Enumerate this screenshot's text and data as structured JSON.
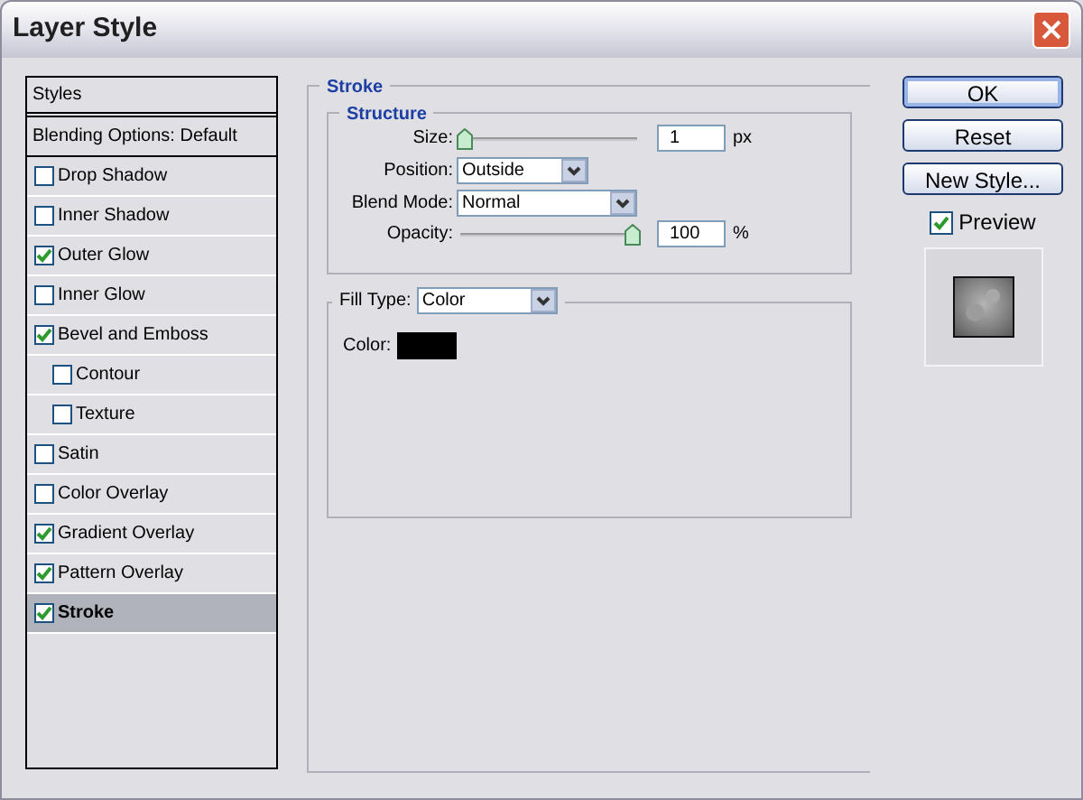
{
  "window": {
    "title": "Layer Style"
  },
  "styles": [
    {
      "kind": "header",
      "label": "Styles"
    },
    {
      "kind": "option",
      "label": "Blending Options: Default",
      "selected": false
    },
    {
      "kind": "effect",
      "label": "Drop Shadow",
      "checked": false,
      "selected": false
    },
    {
      "kind": "effect",
      "label": "Inner Shadow",
      "checked": false,
      "selected": false
    },
    {
      "kind": "effect",
      "label": "Outer Glow",
      "checked": true,
      "selected": false
    },
    {
      "kind": "effect",
      "label": "Inner Glow",
      "checked": false,
      "selected": false
    },
    {
      "kind": "effect",
      "label": "Bevel and Emboss",
      "checked": true,
      "selected": false,
      "children": [
        {
          "kind": "effect",
          "label": "Contour",
          "checked": false,
          "selected": false
        },
        {
          "kind": "effect",
          "label": "Texture",
          "checked": false,
          "selected": false
        }
      ]
    },
    {
      "kind": "effect",
      "label": "Satin",
      "checked": false,
      "selected": false
    },
    {
      "kind": "effect",
      "label": "Color Overlay",
      "checked": false,
      "selected": false
    },
    {
      "kind": "effect",
      "label": "Gradient Overlay",
      "checked": true,
      "selected": false
    },
    {
      "kind": "effect",
      "label": "Pattern Overlay",
      "checked": true,
      "selected": false
    },
    {
      "kind": "effect",
      "label": "Stroke",
      "checked": true,
      "selected": true
    }
  ],
  "stroke": {
    "title": "Stroke",
    "structure": {
      "title": "Structure",
      "size": {
        "label": "Size:",
        "level": 0,
        "value": "1",
        "unit": "px"
      },
      "position": {
        "label": "Position:",
        "value": "Outside"
      },
      "blend_mode": {
        "label": "Blend Mode:",
        "value": "Normal"
      },
      "opacity": {
        "label": "Opacity:",
        "level": 1,
        "value": "100",
        "unit": "%"
      }
    },
    "fill_type": {
      "label": "Fill Type:",
      "value": "Color"
    },
    "color": {
      "label": "Color:",
      "color": "#000000"
    }
  },
  "buttons": [
    "OK",
    "Reset",
    "New Style..."
  ],
  "preview": {
    "label": "Preview",
    "checked": true
  }
}
